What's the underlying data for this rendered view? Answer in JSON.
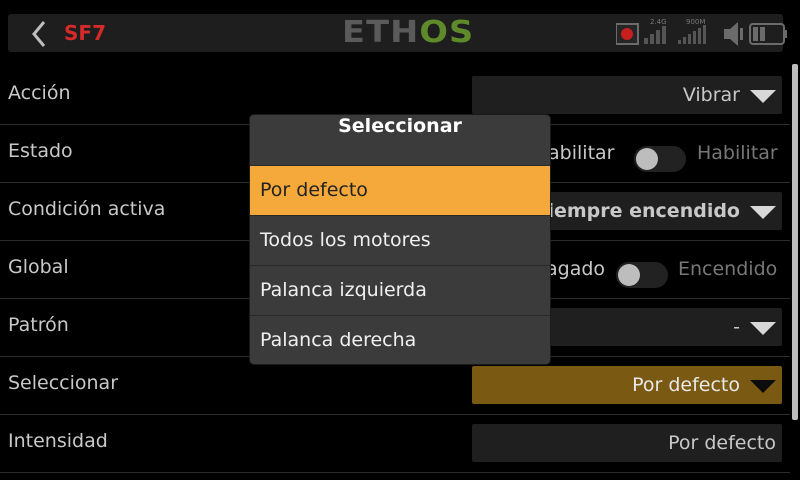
{
  "header": {
    "back_icon": "chevron-left-icon",
    "screen_id": "SF7",
    "logo_left": "ETH",
    "logo_right": "OS",
    "status": {
      "rx_24_label": "2.4G",
      "rx_900_label": "900M",
      "icons": [
        "record-icon",
        "signal-bars-icon",
        "signal-bars-icon",
        "speaker-icon",
        "battery-icon"
      ]
    }
  },
  "rows": [
    {
      "label": "Acción",
      "value": "Vibrar"
    },
    {
      "label": "Estado",
      "off_label": "habilitar",
      "on_label": "Habilitar"
    },
    {
      "label": "Condición activa",
      "value": "Siempre encendido"
    },
    {
      "label": "Global",
      "off_label": "agado",
      "on_label": "Encendido"
    },
    {
      "label": "Patrón",
      "value": "-"
    },
    {
      "label": "Seleccionar",
      "value": "Por defecto"
    },
    {
      "label": "Intensidad",
      "value": "Por defecto"
    }
  ],
  "popup": {
    "title": "Seleccionar",
    "options": [
      "Por defecto",
      "Todos los motores",
      "Palanca izquierda",
      "Palanca derecha"
    ],
    "selected_index": 0
  },
  "colors": {
    "accent": "#f5a93a",
    "active_field": "#7a5a12",
    "title_red": "#d42a2a",
    "logo_green": "#5e8a2a"
  }
}
